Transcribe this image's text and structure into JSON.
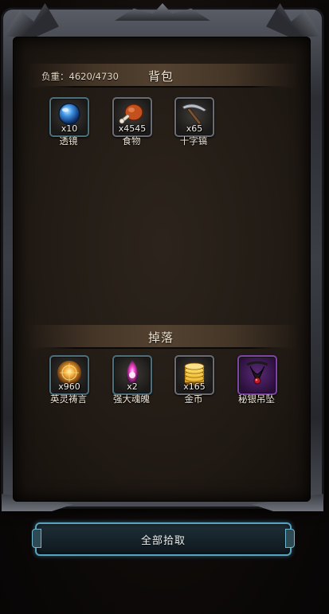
{
  "backpack": {
    "title": "背包",
    "load_label": "负重：",
    "load_value": "4620/4730",
    "items": [
      {
        "name": "透镜",
        "quantity": "x10",
        "icon": "lens-icon"
      },
      {
        "name": "食物",
        "quantity": "x4545",
        "icon": "food-meat-icon"
      },
      {
        "name": "十字镐",
        "quantity": "x65",
        "icon": "pickaxe-icon"
      }
    ]
  },
  "drops": {
    "title": "掉落",
    "items": [
      {
        "name": "英灵祷言",
        "quantity": "x960",
        "icon": "hero-prayer-icon"
      },
      {
        "name": "强大魂魄",
        "quantity": "x2",
        "icon": "soul-orb-icon"
      },
      {
        "name": "金币",
        "quantity": "x165",
        "icon": "gold-coins-icon"
      },
      {
        "name": "秘银吊坠",
        "quantity": "",
        "icon": "mithril-pendant-icon"
      }
    ]
  },
  "actions": {
    "pickup_all_label": "全部拾取"
  },
  "colors": {
    "button_border": "#58a4c0",
    "rare_slot": "#7c45a6",
    "panel_bg": "#221b15"
  }
}
